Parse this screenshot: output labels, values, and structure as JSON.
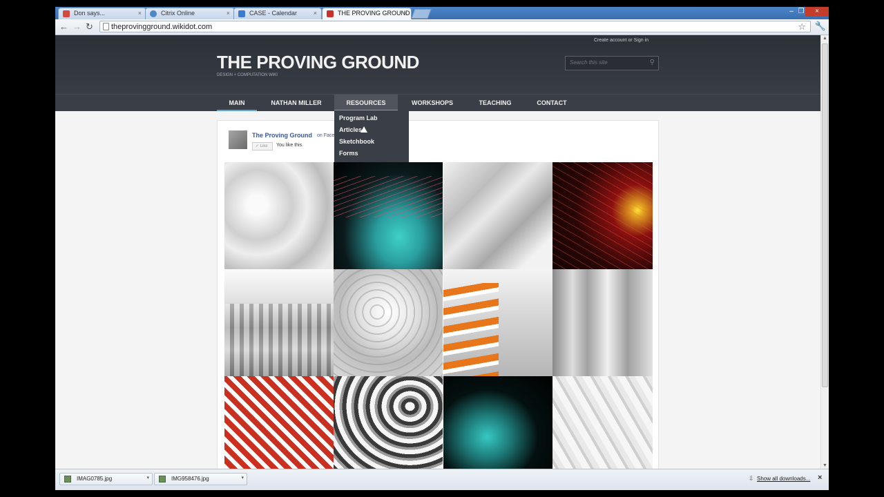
{
  "browser": {
    "tabs": [
      {
        "label": "Don says...",
        "favicon_color": "#d54a3c",
        "active": false
      },
      {
        "label": "Citrix Online",
        "favicon_color": "#4d87c5",
        "active": false
      },
      {
        "label": "CASE - Calendar",
        "favicon_color": "#3b7ad1",
        "active": false
      },
      {
        "label": "THE PROVING GROUND",
        "favicon_color": "#c9312b",
        "active": true
      }
    ],
    "url": "theprovingground.wikidot.com",
    "close_glyph": "×"
  },
  "site": {
    "account_links": {
      "create": "Create account",
      "or": "or",
      "signin": "Sign in"
    },
    "title": "THE PROVING GROUND",
    "subtitle": "DESIGN + COMPUTATION WIKI",
    "search_placeholder": "Search this site",
    "nav": [
      "MAIN",
      "NATHAN MILLER",
      "RESOURCES",
      "WORKSHOPS",
      "TEACHING",
      "CONTACT"
    ],
    "dropdown": [
      "Program Lab",
      "Articles",
      "Sketchbook",
      "Forms"
    ]
  },
  "facebook": {
    "name": "The Proving Ground",
    "sub": "on Face",
    "like": "Like",
    "you_like": "You like this."
  },
  "downloads": {
    "items": [
      "IMAG0785.jpg",
      "IMG958476.jpg"
    ],
    "show_all": "Show all downloads..."
  },
  "colors": {
    "accent": "#5ba4e6",
    "header_bg": "#2c3138",
    "nav_bg": "#3a3f47"
  }
}
